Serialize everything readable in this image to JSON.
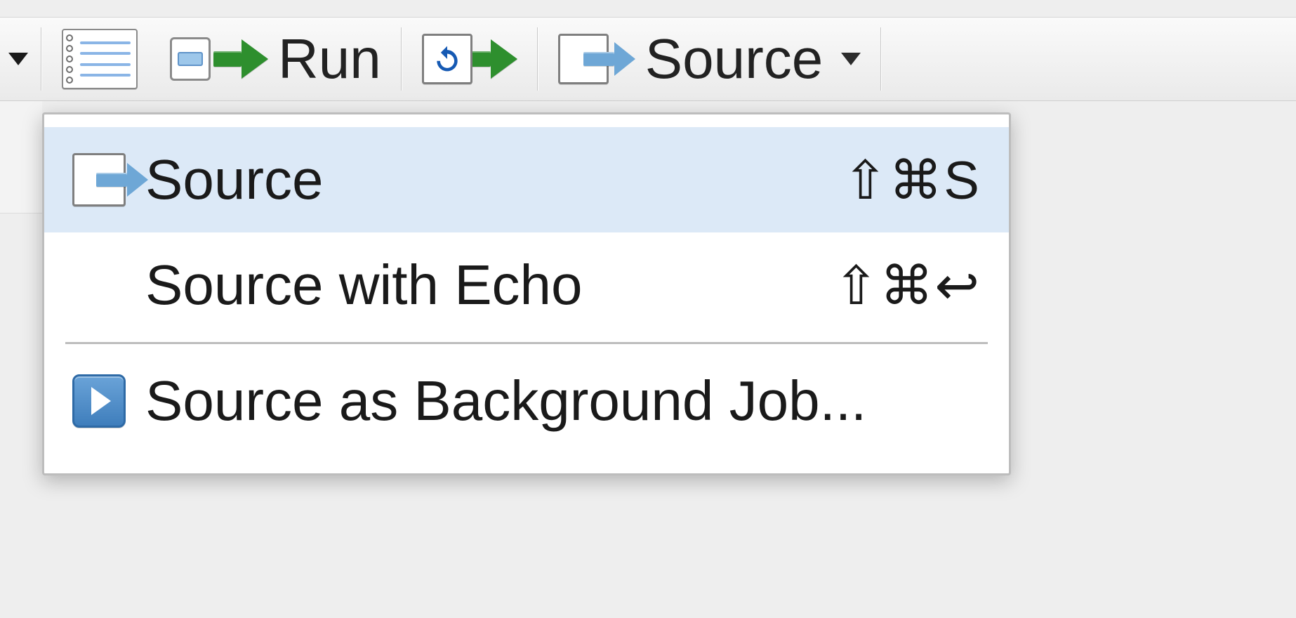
{
  "toolbar": {
    "run_label": "Run",
    "source_label": "Source"
  },
  "menu": {
    "items": [
      {
        "label": "Source",
        "shortcut": "⇧⌘S"
      },
      {
        "label": "Source with Echo",
        "shortcut": "⇧⌘↩"
      },
      {
        "label": "Source as Background Job...",
        "shortcut": ""
      }
    ]
  }
}
